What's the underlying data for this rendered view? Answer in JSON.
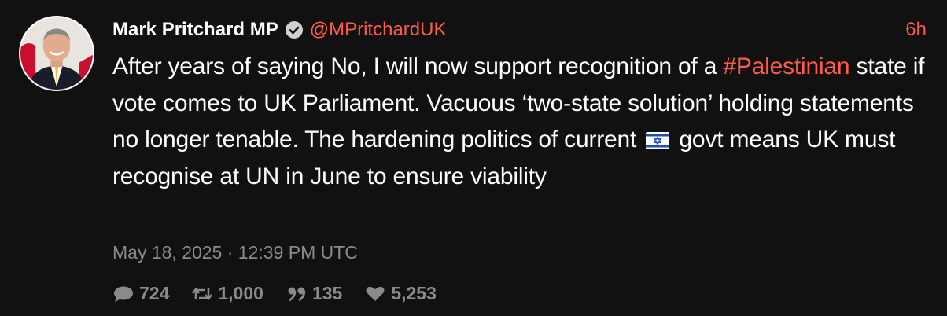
{
  "tweet": {
    "display_name": "Mark Pritchard MP",
    "handle": "@MPritchardUK",
    "relative_time": "6h",
    "text_part1": "After years of saying No, I will now support recognition of a ",
    "hashtag": "#Palestinian",
    "text_part2": " state if vote comes to UK Parliament. Vacuous ‘two-state solution’ holding statements no longer tenable. The hardening politics of current ",
    "flag_icon": "israel-flag-icon",
    "text_part3": " govt means UK must recognise at UN in June to ensure viability",
    "timestamp": "May 18, 2025 · 12:39 PM UTC",
    "stats": {
      "replies": "724",
      "retweets": "1,000",
      "quotes": "135",
      "likes": "5,253"
    }
  },
  "colors": {
    "background": "#111111",
    "accent": "#ff5a4a",
    "muted": "#8a8a8a",
    "text": "#ffffff"
  }
}
